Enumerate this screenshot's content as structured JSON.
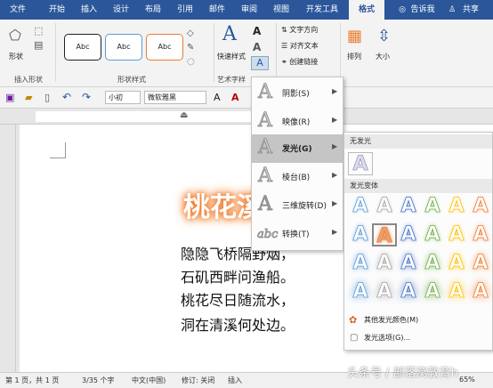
{
  "tabs": [
    {
      "label": "文件"
    },
    {
      "label": "开始"
    },
    {
      "label": "插入"
    },
    {
      "label": "设计"
    },
    {
      "label": "布局"
    },
    {
      "label": "引用"
    },
    {
      "label": "邮件"
    },
    {
      "label": "审阅"
    },
    {
      "label": "视图"
    },
    {
      "label": "开发工具"
    },
    {
      "label": "格式"
    }
  ],
  "tell_me": "告诉我",
  "share": "共享",
  "ribbon": {
    "shape_btn": "形状",
    "insert_shapes_label": "插入形状",
    "style_swatch": "Abc",
    "shape_styles_label": "形状样式",
    "quick_styles": "快速样式",
    "wordart_label": "艺术字样",
    "text_direction": "文字方向",
    "align_text": "对齐文本",
    "create_link": "创建链接",
    "arrange": "排列",
    "size": "大小"
  },
  "qat": {
    "font_size": "小初",
    "font_name": "微软雅黑",
    "font_a": "A",
    "color_a": "A"
  },
  "document": {
    "title": "桃花溪",
    "lines": [
      "隐隐飞桥隔野烟，",
      "石矶西畔问渔船。",
      "桃花尽日随流水，",
      "洞在清溪何处边。"
    ]
  },
  "effects_menu": {
    "items": [
      {
        "glyph": "A",
        "label": "阴影(S)"
      },
      {
        "glyph": "A",
        "label": "映像(R)"
      },
      {
        "glyph": "A",
        "label": "发光(G)"
      },
      {
        "glyph": "A",
        "label": "棱台(B)"
      },
      {
        "glyph": "A",
        "label": "三维旋转(D)"
      },
      {
        "glyph": "abc",
        "label": "转换(T)"
      }
    ],
    "active_index": 2
  },
  "glow_gallery": {
    "no_glow_header": "无发光",
    "variants_header": "发光变体",
    "glyph": "A",
    "colors": [
      "#5b9bd5",
      "#a5a5a5",
      "#4472c4",
      "#70ad47",
      "#ffc000",
      "#ed7d31"
    ],
    "more_colors": "其他发光颜色(M)",
    "options": "发光选项(G)..."
  },
  "status": {
    "page": "第 1 页，共 1 页",
    "words": "3/35 个字",
    "language": "中文(中国)",
    "track": "修订: 关闭",
    "insert": "插入",
    "zoom": "65%"
  },
  "watermark": "头条号 / 部落窝教育h"
}
